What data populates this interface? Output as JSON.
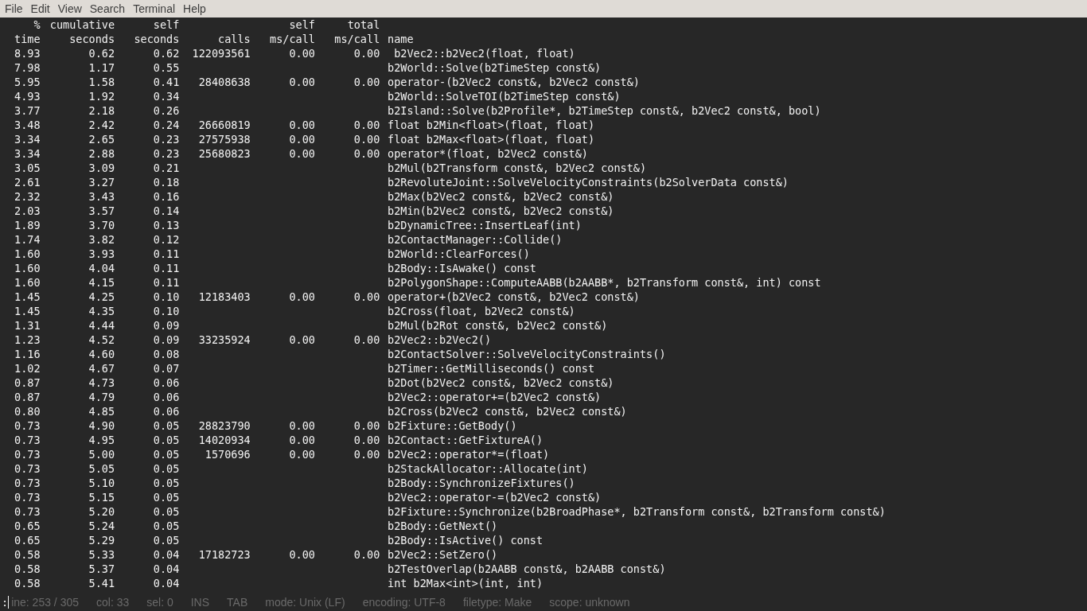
{
  "menu": [
    "File",
    "Edit",
    "View",
    "Search",
    "Terminal",
    "Help"
  ],
  "header": {
    "row_1": {
      "time": "%",
      "cumulative": "cumulative",
      "self": "self",
      "self_ms": "self",
      "total_ms": "total"
    },
    "row_2": [
      "time",
      "seconds",
      "seconds",
      "calls",
      "ms/call",
      "ms/call",
      "name"
    ]
  },
  "rows": [
    {
      "time": "8.93",
      "cumulative": "0.62",
      "self": "0.62",
      "calls": "122093561",
      "self_ms": "0.00",
      "total_ms": "0.00",
      "name": " b2Vec2::b2Vec2(float, float)"
    },
    {
      "time": "7.98",
      "cumulative": "1.17",
      "self": "0.55",
      "name": "b2World::Solve(b2TimeStep const&)"
    },
    {
      "time": "5.95",
      "cumulative": "1.58",
      "self": "0.41",
      "calls": "28408638",
      "self_ms": "0.00",
      "total_ms": "0.00",
      "name": "operator-(b2Vec2 const&, b2Vec2 const&)"
    },
    {
      "time": "4.93",
      "cumulative": "1.92",
      "self": "0.34",
      "name": "b2World::SolveTOI(b2TimeStep const&)"
    },
    {
      "time": "3.77",
      "cumulative": "2.18",
      "self": "0.26",
      "name": "b2Island::Solve(b2Profile*, b2TimeStep const&, b2Vec2 const&, bool)"
    },
    {
      "time": "3.48",
      "cumulative": "2.42",
      "self": "0.24",
      "calls": "26660819",
      "self_ms": "0.00",
      "total_ms": "0.00",
      "name": "float b2Min<float>(float, float)"
    },
    {
      "time": "3.34",
      "cumulative": "2.65",
      "self": "0.23",
      "calls": "27575938",
      "self_ms": "0.00",
      "total_ms": "0.00",
      "name": "float b2Max<float>(float, float)"
    },
    {
      "time": "3.34",
      "cumulative": "2.88",
      "self": "0.23",
      "calls": "25680823",
      "self_ms": "0.00",
      "total_ms": "0.00",
      "name": "operator*(float, b2Vec2 const&)"
    },
    {
      "time": "3.05",
      "cumulative": "3.09",
      "self": "0.21",
      "name": "b2Mul(b2Transform const&, b2Vec2 const&)"
    },
    {
      "time": "2.61",
      "cumulative": "3.27",
      "self": "0.18",
      "name": "b2RevoluteJoint::SolveVelocityConstraints(b2SolverData const&)"
    },
    {
      "time": "2.32",
      "cumulative": "3.43",
      "self": "0.16",
      "name": "b2Max(b2Vec2 const&, b2Vec2 const&)"
    },
    {
      "time": "2.03",
      "cumulative": "3.57",
      "self": "0.14",
      "name": "b2Min(b2Vec2 const&, b2Vec2 const&)"
    },
    {
      "time": "1.89",
      "cumulative": "3.70",
      "self": "0.13",
      "name": "b2DynamicTree::InsertLeaf(int)"
    },
    {
      "time": "1.74",
      "cumulative": "3.82",
      "self": "0.12",
      "name": "b2ContactManager::Collide()"
    },
    {
      "time": "1.60",
      "cumulative": "3.93",
      "self": "0.11",
      "name": "b2World::ClearForces()"
    },
    {
      "time": "1.60",
      "cumulative": "4.04",
      "self": "0.11",
      "name": "b2Body::IsAwake() const"
    },
    {
      "time": "1.60",
      "cumulative": "4.15",
      "self": "0.11",
      "name": "b2PolygonShape::ComputeAABB(b2AABB*, b2Transform const&, int) const"
    },
    {
      "time": "1.45",
      "cumulative": "4.25",
      "self": "0.10",
      "calls": "12183403",
      "self_ms": "0.00",
      "total_ms": "0.00",
      "name": "operator+(b2Vec2 const&, b2Vec2 const&)"
    },
    {
      "time": "1.45",
      "cumulative": "4.35",
      "self": "0.10",
      "name": "b2Cross(float, b2Vec2 const&)"
    },
    {
      "time": "1.31",
      "cumulative": "4.44",
      "self": "0.09",
      "name": "b2Mul(b2Rot const&, b2Vec2 const&)"
    },
    {
      "time": "1.23",
      "cumulative": "4.52",
      "self": "0.09",
      "calls": "33235924",
      "self_ms": "0.00",
      "total_ms": "0.00",
      "name": "b2Vec2::b2Vec2()"
    },
    {
      "time": "1.16",
      "cumulative": "4.60",
      "self": "0.08",
      "name": "b2ContactSolver::SolveVelocityConstraints()"
    },
    {
      "time": "1.02",
      "cumulative": "4.67",
      "self": "0.07",
      "name": "b2Timer::GetMilliseconds() const"
    },
    {
      "time": "0.87",
      "cumulative": "4.73",
      "self": "0.06",
      "name": "b2Dot(b2Vec2 const&, b2Vec2 const&)"
    },
    {
      "time": "0.87",
      "cumulative": "4.79",
      "self": "0.06",
      "name": "b2Vec2::operator+=(b2Vec2 const&)"
    },
    {
      "time": "0.80",
      "cumulative": "4.85",
      "self": "0.06",
      "name": "b2Cross(b2Vec2 const&, b2Vec2 const&)"
    },
    {
      "time": "0.73",
      "cumulative": "4.90",
      "self": "0.05",
      "calls": "28823790",
      "self_ms": "0.00",
      "total_ms": "0.00",
      "name": "b2Fixture::GetBody()"
    },
    {
      "time": "0.73",
      "cumulative": "4.95",
      "self": "0.05",
      "calls": "14020934",
      "self_ms": "0.00",
      "total_ms": "0.00",
      "name": "b2Contact::GetFixtureA()"
    },
    {
      "time": "0.73",
      "cumulative": "5.00",
      "self": "0.05",
      "calls": "1570696",
      "self_ms": "0.00",
      "total_ms": "0.00",
      "name": "b2Vec2::operator*=(float)"
    },
    {
      "time": "0.73",
      "cumulative": "5.05",
      "self": "0.05",
      "name": "b2StackAllocator::Allocate(int)"
    },
    {
      "time": "0.73",
      "cumulative": "5.10",
      "self": "0.05",
      "name": "b2Body::SynchronizeFixtures()"
    },
    {
      "time": "0.73",
      "cumulative": "5.15",
      "self": "0.05",
      "name": "b2Vec2::operator-=(b2Vec2 const&)"
    },
    {
      "time": "0.73",
      "cumulative": "5.20",
      "self": "0.05",
      "name": "b2Fixture::Synchronize(b2BroadPhase*, b2Transform const&, b2Transform const&)"
    },
    {
      "time": "0.65",
      "cumulative": "5.24",
      "self": "0.05",
      "name": "b2Body::GetNext()"
    },
    {
      "time": "0.65",
      "cumulative": "5.29",
      "self": "0.05",
      "name": "b2Body::IsActive() const"
    },
    {
      "time": "0.58",
      "cumulative": "5.33",
      "self": "0.04",
      "calls": "17182723",
      "self_ms": "0.00",
      "total_ms": "0.00",
      "name": "b2Vec2::SetZero()"
    },
    {
      "time": "0.58",
      "cumulative": "5.37",
      "self": "0.04",
      "name": "b2TestOverlap(b2AABB const&, b2AABB const&)"
    },
    {
      "time": "0.58",
      "cumulative": "5.41",
      "self": "0.04",
      "name": "int b2Max<int>(int, int)"
    }
  ],
  "prompt": ":",
  "status_bar": [
    "ine: 253 / 305",
    "col: 33",
    "sel: 0",
    "INS",
    "TAB",
    "mode: Unix (LF)",
    "encoding: UTF-8",
    "filetype: Make",
    "scope: unknown"
  ]
}
